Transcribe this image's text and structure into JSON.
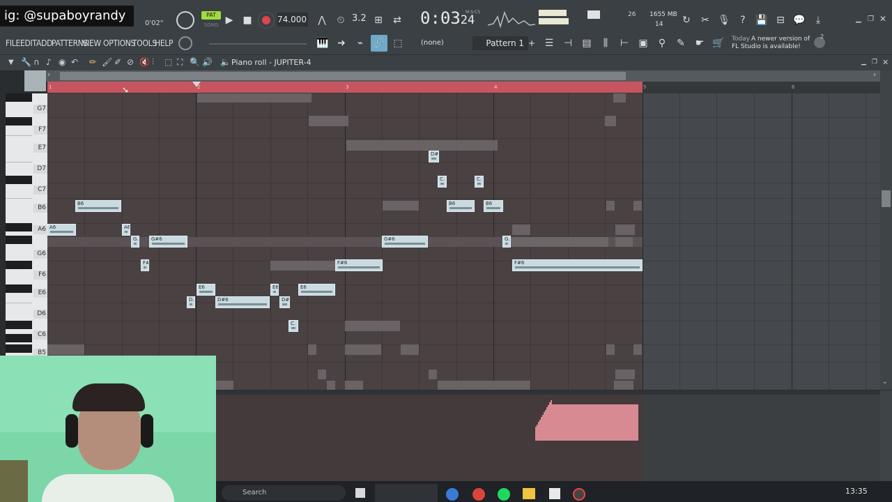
{
  "watermark": "ig: @supaboyrandy",
  "transport": {
    "pat_label": "PAT",
    "song_label": "SONG",
    "tempo": "74.000",
    "time": "0:03",
    "time_frac": "24",
    "time_units": "M:S:CS",
    "small_time": "0'02\"",
    "step_label": "3.2",
    "cpu_num": "26",
    "mem": "1655 MB",
    "voices": "14"
  },
  "menu": [
    "FILE",
    "EDIT",
    "ADD",
    "PATTERNS",
    "VIEW",
    "OPTIONS",
    "TOOLS",
    "HELP"
  ],
  "pattern": {
    "selector_none": "(none)",
    "name": "Pattern 1",
    "add": "+"
  },
  "news": {
    "label": "Today",
    "text": "A newer version of FL Studio is available!",
    "count": "2"
  },
  "piano_roll": {
    "title": "Piano roll - JUPITER-4",
    "ruler_marks": [
      "1",
      "2",
      "3",
      "4",
      "5",
      "6"
    ],
    "key_labels": [
      "G7",
      "F7",
      "E7",
      "D7",
      "C7",
      "B6",
      "A6",
      "G6",
      "F6",
      "E6",
      "D6",
      "C6",
      "B5"
    ],
    "notes": [
      {
        "label": "B6"
      },
      {
        "label": "A6"
      },
      {
        "label": "A6"
      },
      {
        "label": "G."
      },
      {
        "label": "G#6"
      },
      {
        "label": "F#6"
      },
      {
        "label": "D."
      },
      {
        "label": "E6"
      },
      {
        "label": "D#6"
      },
      {
        "label": "E6"
      },
      {
        "label": "D#6"
      },
      {
        "label": "E6"
      },
      {
        "label": "C."
      },
      {
        "label": "F#6"
      },
      {
        "label": "G#6"
      },
      {
        "label": "D#7"
      },
      {
        "label": "C."
      },
      {
        "label": "B6"
      },
      {
        "label": "C."
      },
      {
        "label": "B6"
      },
      {
        "label": "G."
      },
      {
        "label": "F#6"
      }
    ]
  },
  "taskbar": {
    "search": "Search",
    "clock": "13:35"
  },
  "colors": {
    "loop_region": "#c7555f",
    "note": "#c9dbe0",
    "ghost": "#6f6a6b",
    "event": "#d88a93"
  }
}
